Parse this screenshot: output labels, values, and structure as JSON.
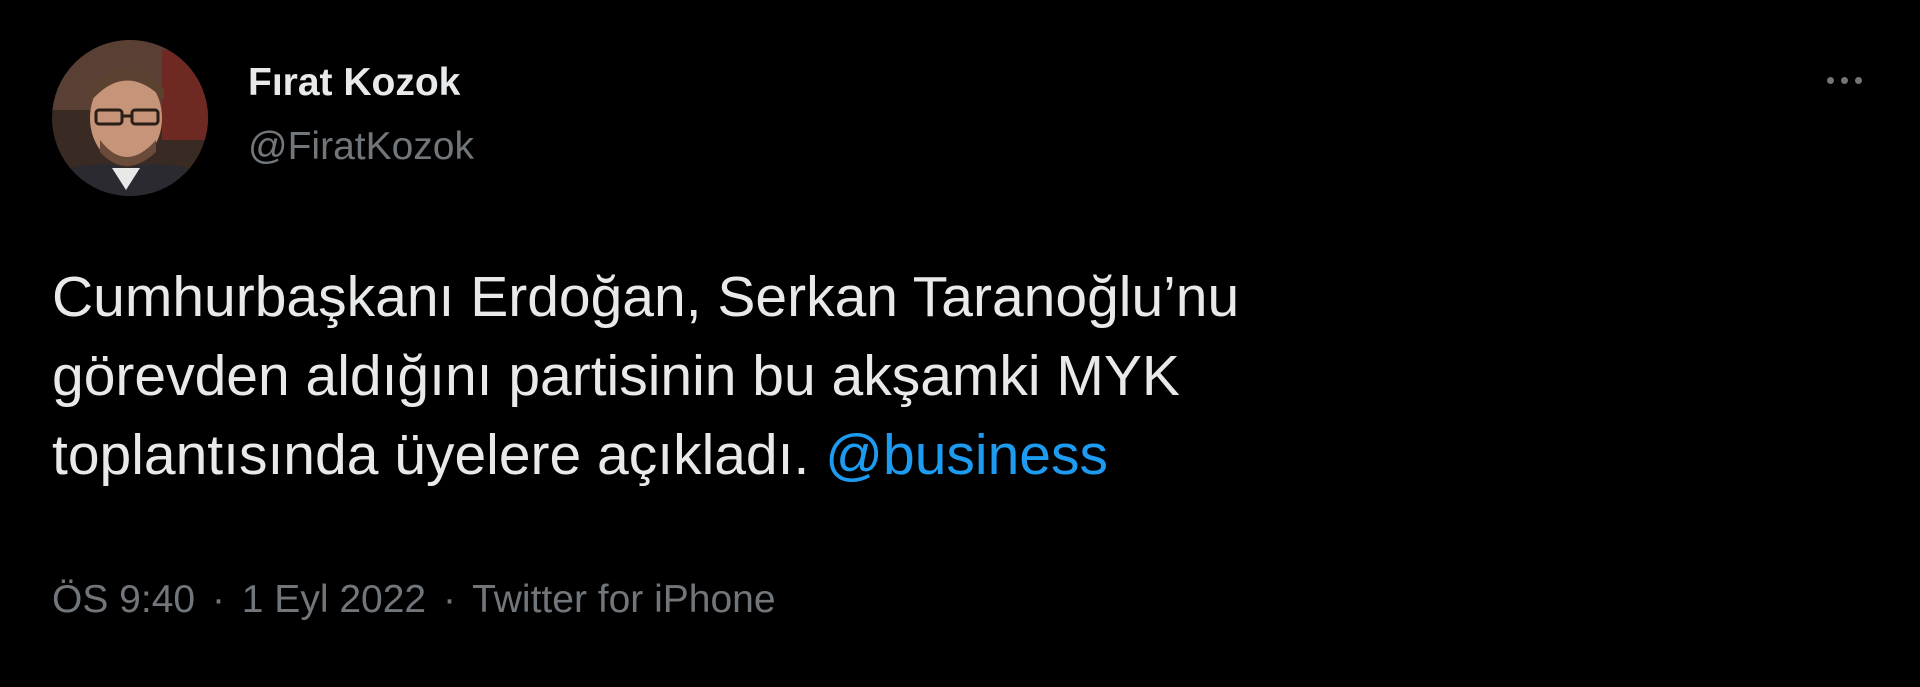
{
  "tweet": {
    "author": {
      "display_name": "Fırat Kozok",
      "handle": "@FiratKozok"
    },
    "text": {
      "line1": "Cumhurbaşkanı Erdoğan, Serkan Taranoğlu’nu",
      "line2": "görevden aldığını partisinin bu akşamki MYK",
      "line3": "toplantısında üyelere açıkladı.",
      "mention": "@business"
    },
    "meta": {
      "time": "ÖS 9:40",
      "separator": "·",
      "date": "1 Eyl 2022",
      "source": "Twitter for iPhone"
    },
    "icons": {
      "more": "more-horizontal-icon"
    },
    "colors": {
      "background": "#000000",
      "primary_text": "#e7e9ea",
      "secondary_text": "#71767b",
      "link": "#1d9bf0"
    }
  }
}
